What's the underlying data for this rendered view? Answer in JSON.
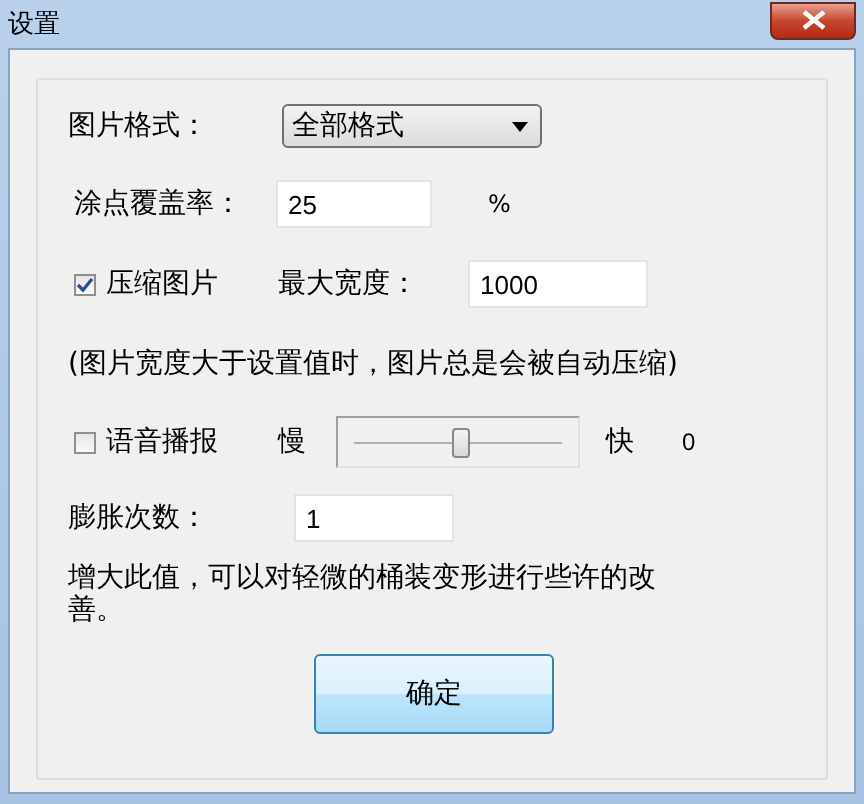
{
  "window": {
    "title": "设置"
  },
  "image_format": {
    "label": "图片格式：",
    "value": "全部格式"
  },
  "coverage": {
    "label": "涂点覆盖率：",
    "value": "25",
    "unit": "%"
  },
  "compress": {
    "label": "压缩图片",
    "checked": true,
    "width_label": "最大宽度：",
    "width_value": "1000"
  },
  "note": "(图片宽度大于设置值时，图片总是会被自动压缩)",
  "voice": {
    "label": "语音播报",
    "checked": false,
    "slow": "慢",
    "fast": "快",
    "level": 0.5,
    "reading": "0"
  },
  "dilation": {
    "label": "膨胀次数：",
    "value": "1"
  },
  "description": "增大此值，可以对轻微的桶装变形进行些许的改善。",
  "ok_button": "确定"
}
